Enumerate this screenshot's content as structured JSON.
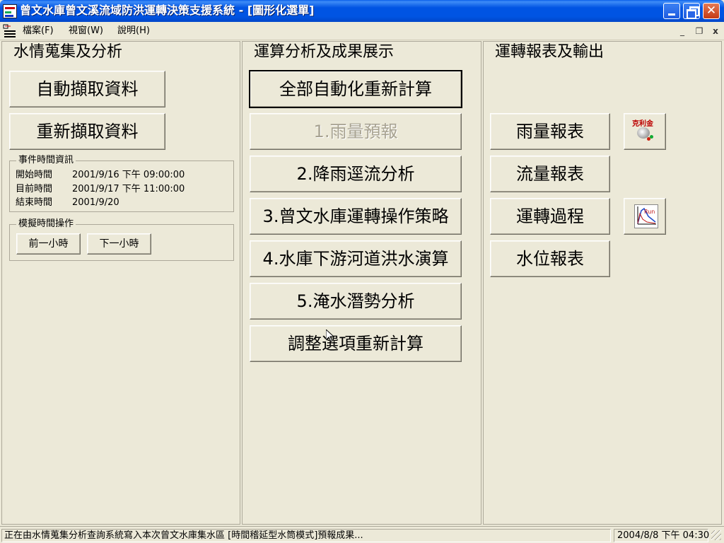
{
  "window": {
    "title": "曾文水庫曾文溪流域防洪運轉決策支援系統 - [圖形化選單]",
    "close_glyph": "✕"
  },
  "menu": {
    "file": "檔案(F)",
    "window": "視窗(W)",
    "help": "說明(H)",
    "mdi_min": "_",
    "mdi_restore": "❐",
    "mdi_close": "x"
  },
  "left_panel": {
    "title": "水情蒐集及分析",
    "auto_fetch": "自動擷取資料",
    "refetch": "重新擷取資料",
    "event_group": {
      "title": "事件時間資訊",
      "rows": [
        {
          "label": "開始時間",
          "value": "2001/9/16 下午 09:00:00"
        },
        {
          "label": "目前時間",
          "value": "2001/9/17 下午 11:00:00"
        },
        {
          "label": "結束時間",
          "value": "2001/9/20"
        }
      ]
    },
    "sim_group": {
      "title": "模擬時間操作",
      "prev_hour": "前一小時",
      "next_hour": "下一小時"
    }
  },
  "mid_panel": {
    "title": "運算分析及成果展示",
    "buttons": [
      "全部自動化重新計算",
      "1.雨量預報",
      "2.降雨逕流分析",
      "3.曾文水庫運轉操作策略",
      "4.水庫下游河道洪水演算",
      "5.淹水潛勢分析",
      "調整選項重新計算"
    ]
  },
  "right_panel": {
    "title": "運轉報表及輸出",
    "rain_report": "雨量報表",
    "flow_report": "流量報表",
    "operation_process": "運轉過程",
    "water_level_report": "水位報表",
    "kriging_icon_label": "克利金",
    "runoff_icon_label": "Run off"
  },
  "status": {
    "message": "正在由水情蒐集分析查詢系統寫入本次曾文水庫集水區 [時間稽延型水筒模式]預報成果...",
    "datetime": "2004/8/8   下午 04:30"
  },
  "colors": {
    "titlebar": "#0054E3",
    "face": "#ECE9D8",
    "close": "#C43A14"
  }
}
